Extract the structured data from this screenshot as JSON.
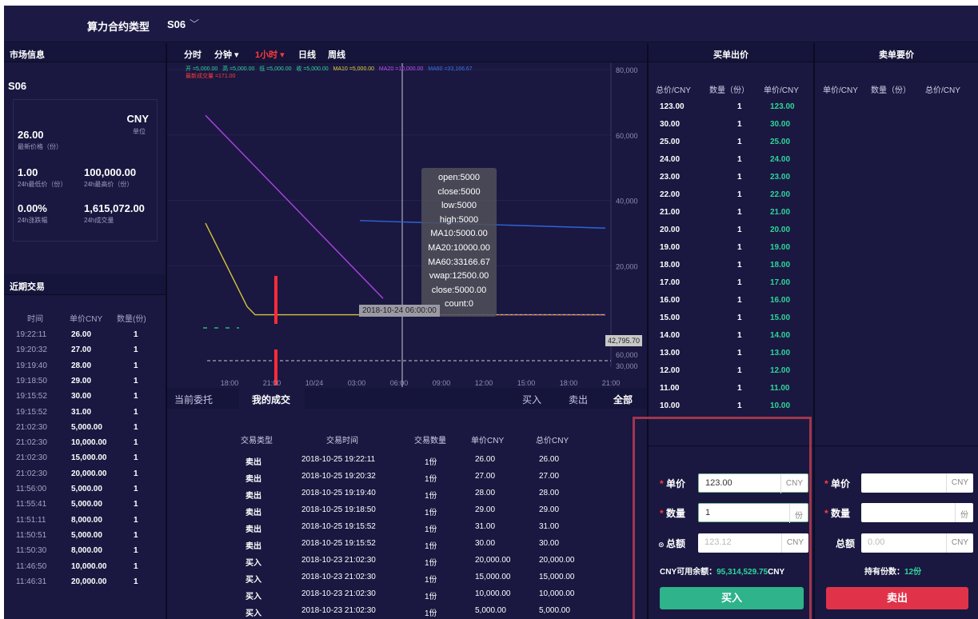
{
  "topbar": {
    "label": "算力合约类型",
    "selected": "S06"
  },
  "market": {
    "header": "市场信息",
    "symbol": "S06",
    "unit_cny": "CNY",
    "unit_label": "单位",
    "last_price": "26.00",
    "last_price_label": "最新价格（份）",
    "low24": "1.00",
    "low24_label": "24h最低价（份）",
    "high24": "100,000.00",
    "high24_label": "24h最高价（份）",
    "change24": "0.00%",
    "change24_label": "24h涨跌幅",
    "volume24": "1,615,072.00",
    "volume24_label": "24h成交量"
  },
  "recent": {
    "header": "近期交易",
    "columns": [
      "时间",
      "单价CNY",
      "数量(份)"
    ],
    "rows": [
      [
        "19:22:11",
        "26.00",
        "1"
      ],
      [
        "19:20:32",
        "27.00",
        "1"
      ],
      [
        "19:19:40",
        "28.00",
        "1"
      ],
      [
        "19:18:50",
        "29.00",
        "1"
      ],
      [
        "19:15:52",
        "30.00",
        "1"
      ],
      [
        "19:15:52",
        "31.00",
        "1"
      ],
      [
        "21:02:30",
        "5,000.00",
        "1"
      ],
      [
        "21:02:30",
        "10,000.00",
        "1"
      ],
      [
        "21:02:30",
        "15,000.00",
        "1"
      ],
      [
        "21:02:30",
        "20,000.00",
        "1"
      ],
      [
        "11:56:00",
        "5,000.00",
        "1"
      ],
      [
        "11:55:41",
        "5,000.00",
        "1"
      ],
      [
        "11:51:11",
        "8,000.00",
        "1"
      ],
      [
        "11:50:51",
        "5,000.00",
        "1"
      ],
      [
        "11:50:30",
        "8,000.00",
        "1"
      ],
      [
        "11:46:50",
        "10,000.00",
        "1"
      ],
      [
        "11:46:31",
        "20,000.00",
        "1"
      ]
    ]
  },
  "chart": {
    "intervals": [
      "分时",
      "分钟 ▾",
      "1小时 ▾",
      "日线",
      "周线"
    ],
    "legend": [
      "开 =5,000.00",
      "高 =5,000.00",
      "低 =5,000.00",
      "收 =5,000.00",
      "MA10 =5,000.00",
      "MA20 =10,000.00",
      "MA60 =33,166.67"
    ],
    "last_trade": "最新成交量 =171.00",
    "tooltip": [
      "open:5000",
      "close:5000",
      "low:5000",
      "high:5000",
      "MA10:5000.00",
      "MA20:10000.00",
      "MA60:33166.67",
      "vwap:12500.00",
      "close:5000.00",
      "count:0"
    ],
    "crosshair_time": "2018-10-24 06:00:00",
    "price_marker": "42,795.70",
    "colors": {
      "ma10": "#d9c23a",
      "ma20": "#b041e8",
      "ma60": "#2f64d8",
      "volume": "#ff2b3a",
      "up": "#2fd59a"
    }
  },
  "chart_data": {
    "type": "line",
    "x_ticks": [
      "18:00",
      "21:00",
      "10/24",
      "03:00",
      "06:00",
      "09:00",
      "12:00",
      "15:00",
      "18:00",
      "21:00"
    ],
    "price_ticks": [
      "80,000",
      "60,000",
      "40,000",
      "20,000"
    ],
    "volume_ticks": [
      "60,000",
      "30,000",
      "0"
    ],
    "series": [
      {
        "name": "MA10",
        "values": [
          33000,
          7500,
          5000,
          5000,
          5000,
          5000,
          5000,
          5000,
          5000,
          5000
        ]
      },
      {
        "name": "MA20",
        "values": [
          66000,
          55000,
          43000,
          31000,
          19000,
          10000,
          10000,
          10000,
          10000,
          10000
        ]
      },
      {
        "name": "MA60",
        "values": [
          null,
          null,
          null,
          34000,
          33500,
          33166.67,
          32800,
          32400,
          32000,
          31500
        ]
      }
    ]
  },
  "orders": {
    "tabs": [
      "当前委托",
      "我的成交"
    ],
    "filters": [
      "买入",
      "卖出",
      "全部"
    ],
    "columns": [
      "交易类型",
      "交易时间",
      "交易数量",
      "单价CNY",
      "总价CNY"
    ],
    "rows": [
      [
        "卖出",
        "2018-10-25 19:22:11",
        "1份",
        "26.00",
        "26.00"
      ],
      [
        "卖出",
        "2018-10-25 19:20:32",
        "1份",
        "27.00",
        "27.00"
      ],
      [
        "卖出",
        "2018-10-25 19:19:40",
        "1份",
        "28.00",
        "28.00"
      ],
      [
        "卖出",
        "2018-10-25 19:18:50",
        "1份",
        "29.00",
        "29.00"
      ],
      [
        "卖出",
        "2018-10-25 19:15:52",
        "1份",
        "31.00",
        "31.00"
      ],
      [
        "卖出",
        "2018-10-25 19:15:52",
        "1份",
        "30.00",
        "30.00"
      ],
      [
        "买入",
        "2018-10-23 21:02:30",
        "1份",
        "20,000.00",
        "20,000.00"
      ],
      [
        "买入",
        "2018-10-23 21:02:30",
        "1份",
        "15,000.00",
        "15,000.00"
      ],
      [
        "买入",
        "2018-10-23 21:02:30",
        "1份",
        "10,000.00",
        "10,000.00"
      ],
      [
        "买入",
        "2018-10-23 21:02:30",
        "1份",
        "5,000.00",
        "5,000.00"
      ]
    ]
  },
  "buy_book": {
    "header": "买单出价",
    "columns": [
      "总价/CNY",
      "数量（份）",
      "单价/CNY"
    ],
    "rows": [
      [
        "123.00",
        "1",
        "123.00"
      ],
      [
        "30.00",
        "1",
        "30.00"
      ],
      [
        "25.00",
        "1",
        "25.00"
      ],
      [
        "24.00",
        "1",
        "24.00"
      ],
      [
        "23.00",
        "1",
        "23.00"
      ],
      [
        "22.00",
        "1",
        "22.00"
      ],
      [
        "21.00",
        "1",
        "21.00"
      ],
      [
        "20.00",
        "1",
        "20.00"
      ],
      [
        "19.00",
        "1",
        "19.00"
      ],
      [
        "18.00",
        "1",
        "18.00"
      ],
      [
        "17.00",
        "1",
        "17.00"
      ],
      [
        "16.00",
        "1",
        "16.00"
      ],
      [
        "15.00",
        "1",
        "15.00"
      ],
      [
        "14.00",
        "1",
        "14.00"
      ],
      [
        "13.00",
        "1",
        "13.00"
      ],
      [
        "12.00",
        "1",
        "12.00"
      ],
      [
        "11.00",
        "1",
        "11.00"
      ],
      [
        "10.00",
        "1",
        "10.00"
      ]
    ]
  },
  "sell_book": {
    "header": "卖单要价",
    "columns": [
      "单价/CNY",
      "数量（份）",
      "总价/CNY"
    ]
  },
  "buy_form": {
    "price_label": "单价",
    "price_value": "123.00",
    "price_unit": "CNY",
    "qty_label": "数量",
    "qty_value": "1",
    "qty_unit": "份",
    "total_label": "总额",
    "total_placeholder": "123.12",
    "total_unit": "CNY",
    "balance_label": "CNY可用余额：",
    "balance_value": "95,314,529.75",
    "balance_unit": "CNY",
    "button": "买入"
  },
  "sell_form": {
    "price_label": "单价",
    "price_unit": "CNY",
    "qty_label": "数量",
    "qty_unit": "份",
    "total_label": "总额",
    "total_placeholder": "0.00",
    "total_unit": "CNY",
    "holding_label": "持有份数：",
    "holding_value": "12份",
    "button": "卖出"
  }
}
